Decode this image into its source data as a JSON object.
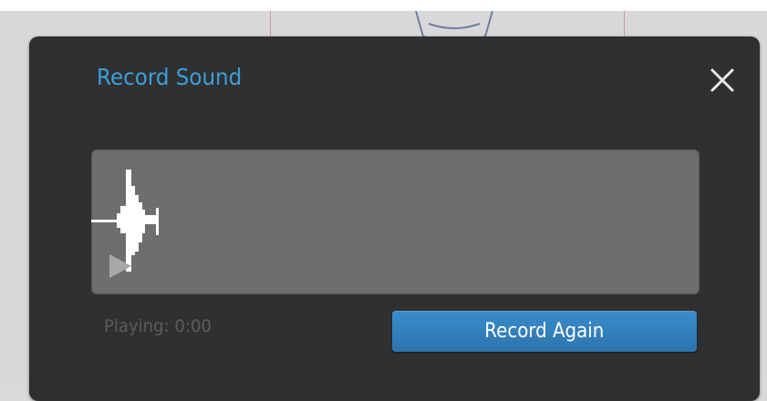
{
  "dialog": {
    "title": "Record Sound",
    "close_icon": "close-icon"
  },
  "playback": {
    "status": "Playing: 0:00",
    "play_icon": "play-icon"
  },
  "actions": {
    "record_again_label": "Record Again"
  },
  "colors": {
    "dialog_bg": "#303030",
    "title": "#3b9fdc",
    "waveform_panel": "#6e6e6e",
    "button": "#3380bd",
    "status_text": "#5b5b5b",
    "waveform": "#ffffff"
  }
}
